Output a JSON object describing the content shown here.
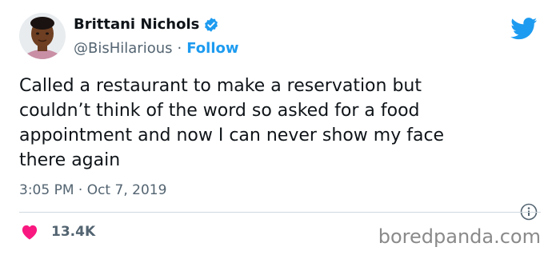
{
  "author": {
    "name": "Brittani Nichols",
    "handle": "@BisHilarious",
    "separator": "·",
    "follow_label": "Follow",
    "verified": true,
    "verified_color": "#1d9bf0"
  },
  "tweet": {
    "text": "Called a restaurant to make a reservation but\ncouldn’t think of the word so asked for a food\nappointment and now I can never show my face\nthere again",
    "timestamp": "3:05 PM · Oct 7, 2019"
  },
  "engagement": {
    "likes": "13.4K",
    "heart_color": "#f91880"
  },
  "brand": {
    "platform_icon": "twitter-bird-icon",
    "platform_color": "#1d9bf0"
  },
  "watermark": "boredpanda.com"
}
